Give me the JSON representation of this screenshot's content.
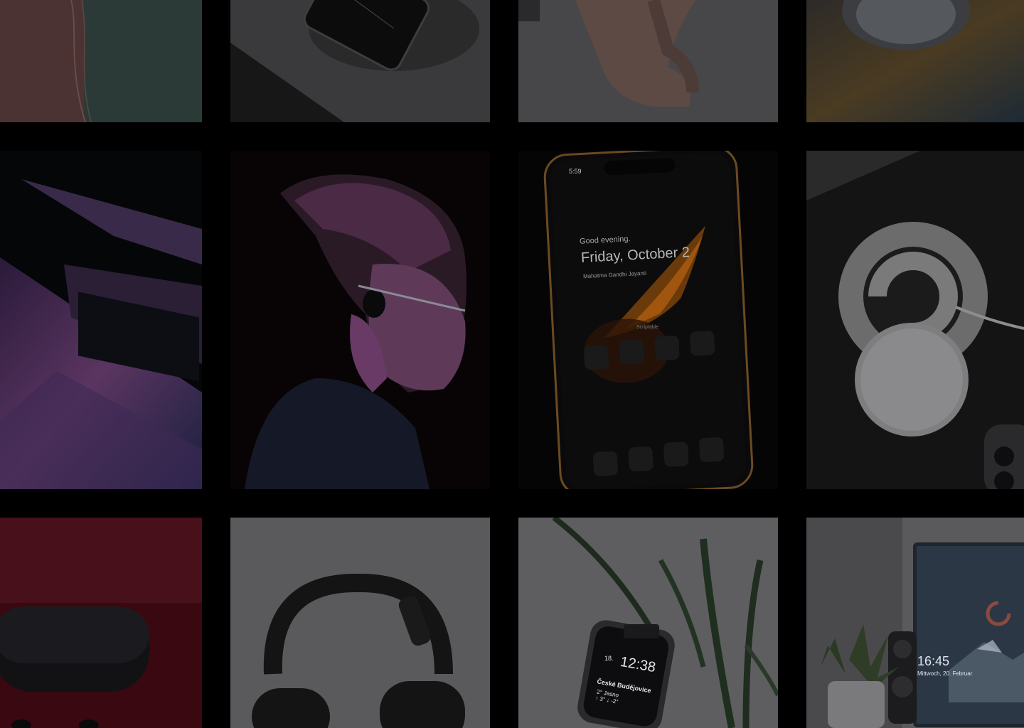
{
  "gallery": {
    "tiles": [
      {
        "id": "pastel-cable",
        "icon": "photo-icon"
      },
      {
        "id": "phone-on-charger",
        "icon": "photo-icon"
      },
      {
        "id": "pink-band",
        "icon": "photo-icon"
      },
      {
        "id": "silver-orb",
        "icon": "photo-icon"
      },
      {
        "id": "laptop-keyboard",
        "icon": "photo-icon"
      },
      {
        "id": "man-with-earbuds",
        "icon": "photo-icon"
      },
      {
        "id": "phone-homescreen",
        "icon": "photo-icon"
      },
      {
        "id": "magsafe-stand",
        "icon": "photo-icon"
      },
      {
        "id": "earbuds-case",
        "icon": "photo-icon"
      },
      {
        "id": "headphones",
        "icon": "photo-icon"
      },
      {
        "id": "smartwatch-plant",
        "icon": "photo-icon"
      },
      {
        "id": "monitor-desk",
        "icon": "photo-icon"
      }
    ]
  },
  "phone_screen": {
    "time": "5:59",
    "greeting": "Good evening.",
    "date": "Friday, October 2",
    "holiday": "Mahatma Gandhi Jayanti",
    "widget_label": "Scriptable"
  },
  "watch_screen": {
    "date_num": "18.",
    "time": "12:38",
    "city": "České Budějovice",
    "weather": "2° Jasno",
    "minmax": "↑ 3° ↓ -2°"
  },
  "monitor_screen": {
    "time": "16:45",
    "date": "Mittwoch, 20. Februar"
  },
  "colors": {
    "background": "#000000",
    "accent_orange": "#e07a1f",
    "accent_magenta": "#b23a8a"
  }
}
